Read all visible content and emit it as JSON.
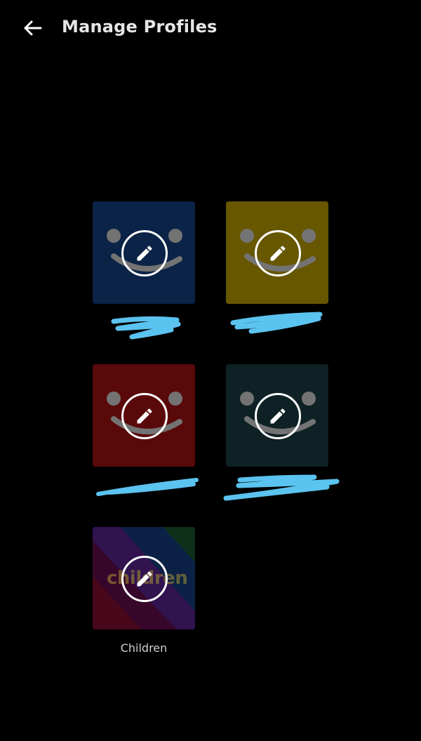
{
  "header": {
    "title": "Manage Profiles",
    "back_icon": "arrow-left-icon"
  },
  "profiles": [
    {
      "name": "",
      "color": "#0b2a5a",
      "redacted": true
    },
    {
      "name": "",
      "color": "#8a7400",
      "redacted": true
    },
    {
      "name": "",
      "color": "#7a0a0a",
      "redacted": true
    },
    {
      "name": "",
      "color": "#122b30",
      "redacted": true
    },
    {
      "name": "Children",
      "color": "#3a2470",
      "redacted": false,
      "logo_text": "children"
    }
  ],
  "icons": {
    "edit": "pencil-icon",
    "redaction": "#5bc3f0"
  }
}
